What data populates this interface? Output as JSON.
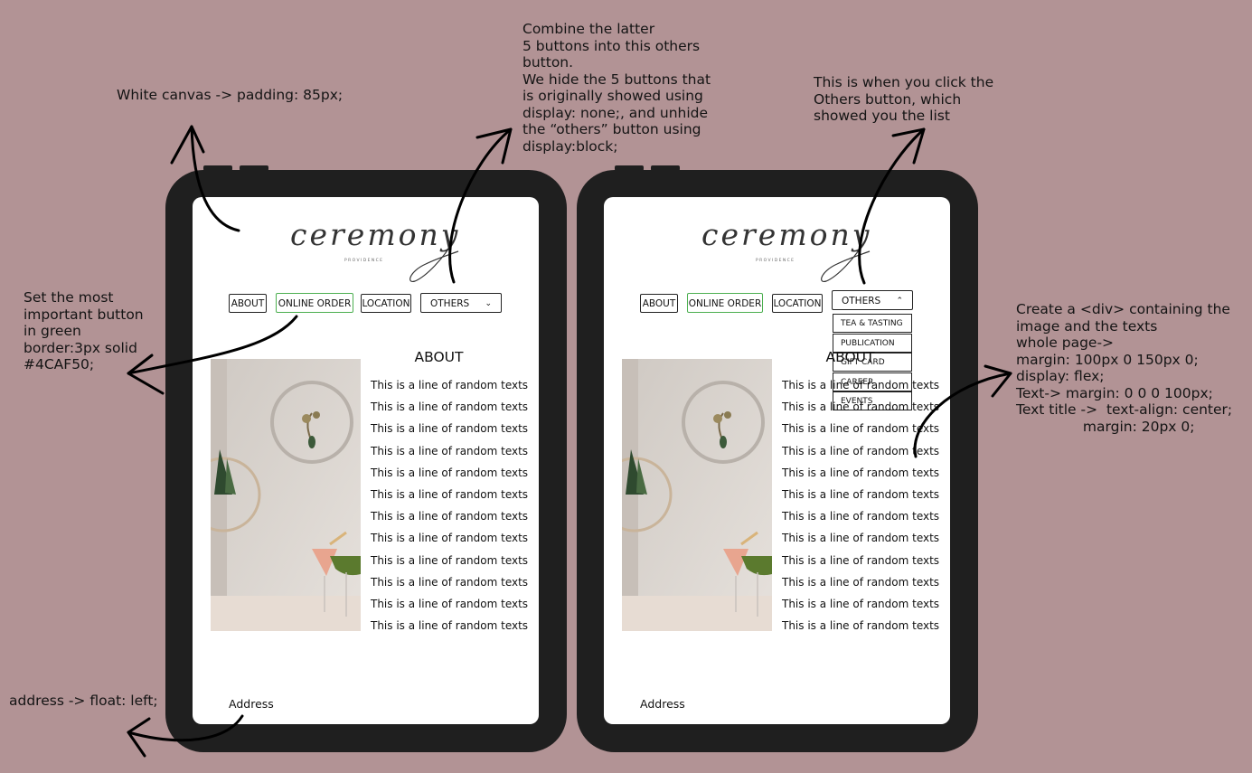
{
  "notes": {
    "padding": "White canvas -> padding: 85px;",
    "combine": "Combine the latter\n5 buttons into this others\nbutton.\nWe hide the 5 buttons that\nis originally showed using\ndisplay: none;, and unhide\nthe “others” button using\ndisplay:block;",
    "click_others": "This is when you click the\nOthers button, which\nshowed you the list",
    "important_button": "Set the most\nimportant button\nin green\nborder:3px solid\n#4CAF50;",
    "div_layout": "Create a <div> containing the\nimage and the texts\nwhole page->\nmargin: 100px 0 150px 0;\ndisplay: flex;\nText-> margin: 0 0 0 100px;\nText title ->  text-align: center;\n               margin: 20px 0;",
    "address_float": "address -> float: left;"
  },
  "site": {
    "logo": "ceremony",
    "logo_sub": "PROVIDENCE",
    "nav": {
      "about": "ABOUT",
      "online_order": "ONLINE ORDER",
      "location": "LOCATION",
      "others": "OTHERS"
    },
    "dropdown": [
      "TEA & TASTING",
      "PUBLICATION",
      "GIFT CARD",
      "CAREER",
      "EVENTS"
    ],
    "section_title": "ABOUT",
    "text_lines": [
      "This is a line of random texts",
      "This is a line of random texts",
      "This is a line of random texts",
      "This is a line of random texts",
      "This is a line of random texts",
      "This is a line of random texts",
      "This is a line of random texts",
      "This is a line of random texts",
      "This is a line of random texts",
      "This is a line of random texts",
      "This is a line of random texts",
      "This is a line of random texts"
    ],
    "address": "Address"
  },
  "colors": {
    "background": "#b29395",
    "device_frame": "#1f1f1f",
    "primary_border": "#4CAF50"
  }
}
